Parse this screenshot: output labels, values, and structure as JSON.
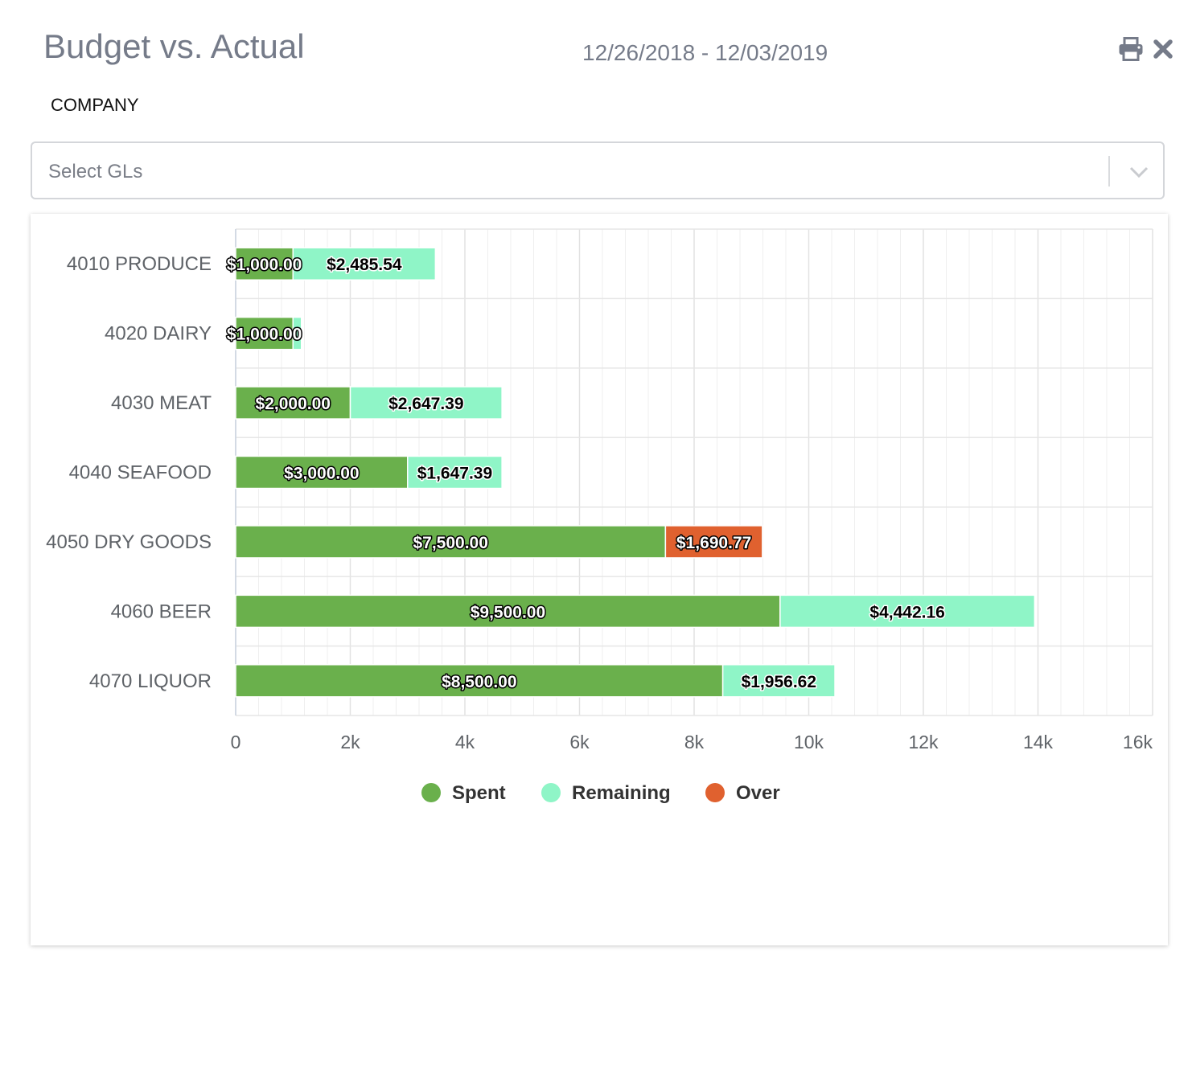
{
  "header": {
    "title": "Budget vs. Actual",
    "date_range": "12/26/2018 - 12/03/2019",
    "print_icon": "print-icon",
    "close_icon": "close-icon"
  },
  "company_label": "COMPANY",
  "gl_select": {
    "placeholder": "Select GLs",
    "chevron_icon": "chevron-down-icon"
  },
  "colors": {
    "spent": "#6ab04c",
    "remaining": "#8ff5c7",
    "over": "#e0612f",
    "title_text": "#757b89",
    "grid": "#e6e6e6"
  },
  "chart_data": {
    "type": "bar",
    "orientation": "horizontal",
    "stacked": true,
    "categories": [
      "4010 PRODUCE",
      "4020 DAIRY",
      "4030 MEAT",
      "4040 SEAFOOD",
      "4050 DRY GOODS",
      "4060 BEER",
      "4070 LIQUOR"
    ],
    "series": [
      {
        "name": "Spent",
        "values": [
          1000,
          1000,
          2000,
          3000,
          7500,
          9500,
          8500
        ],
        "labels": [
          "$1,000.00",
          "$1,000.00",
          "$2,000.00",
          "$3,000.00",
          "$7,500.00",
          "$9,500.00",
          "$8,500.00"
        ]
      },
      {
        "name": "Remaining",
        "values": [
          2485.54,
          147.39,
          2647.39,
          1647.39,
          0,
          4442.16,
          1956.62
        ],
        "labels": [
          "$2,485.54",
          "",
          "$2,647.39",
          "$1,647.39",
          "",
          "$4,442.16",
          "$1,956.62"
        ]
      },
      {
        "name": "Over",
        "values": [
          0,
          0,
          0,
          0,
          1690.77,
          0,
          0
        ],
        "labels": [
          "",
          "",
          "",
          "",
          "$1,690.77",
          "",
          ""
        ]
      }
    ],
    "x_ticks": [
      0,
      2000,
      4000,
      6000,
      8000,
      10000,
      12000,
      14000,
      16000
    ],
    "x_tick_labels": [
      "0",
      "2k",
      "4k",
      "6k",
      "8k",
      "10k",
      "12k",
      "14k",
      "16k"
    ],
    "xlim": [
      0,
      16000
    ],
    "minor_grid_step": 400,
    "grid": true,
    "legend": {
      "position": "bottom",
      "items": [
        "Spent",
        "Remaining",
        "Over"
      ]
    }
  }
}
